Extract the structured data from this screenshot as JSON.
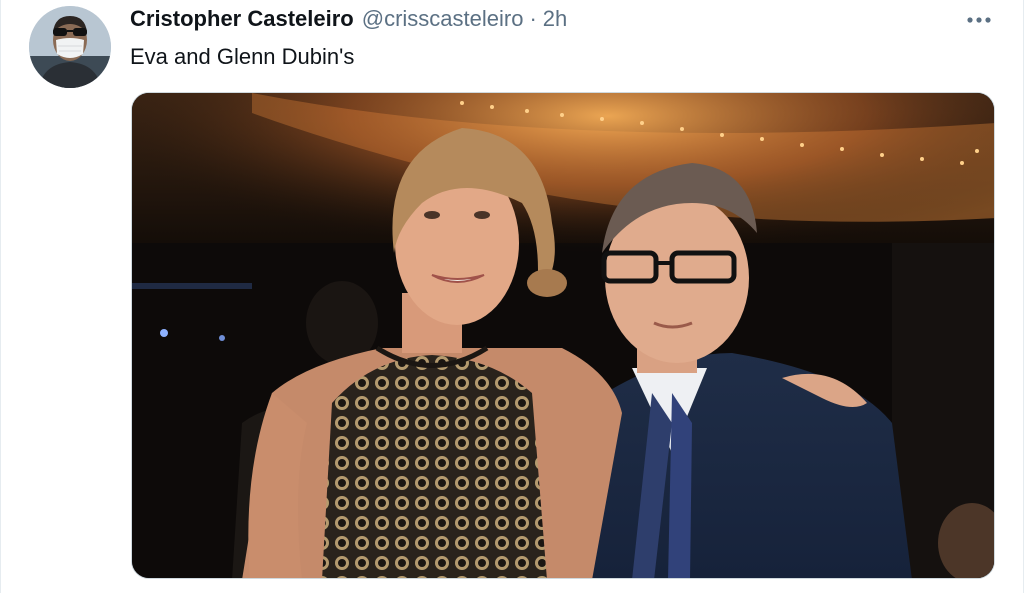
{
  "tweet": {
    "author": {
      "display_name": "Cristopher Casteleiro",
      "handle": "@crisscasteleiro",
      "avatar_icon": "user-avatar-masked"
    },
    "separator": "·",
    "time": "2h",
    "text": "Eva and Glenn Dubin's",
    "more_icon": "more-horizontal-icon",
    "media": {
      "kind": "photo",
      "subject": "two people posing at an evening event"
    }
  },
  "colors": {
    "primary_text": "#0f1419",
    "secondary_text": "#5b7083",
    "border": "#cfd9de"
  }
}
